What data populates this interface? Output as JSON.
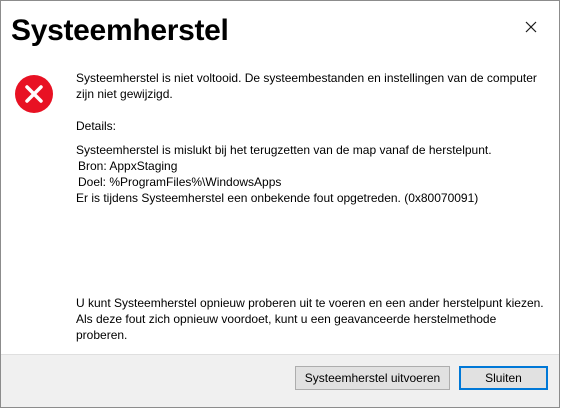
{
  "dialog": {
    "title": "Systeemherstel",
    "icons": {
      "close": "close-icon",
      "status": "error-icon"
    },
    "colors": {
      "error_red": "#e81123",
      "accent_blue": "#0078d7"
    },
    "message": {
      "summary": "Systeemherstel is niet voltooid. De systeembestanden en instellingen van de computer zijn niet gewijzigd.",
      "details_label": "Details:",
      "details_line1": "Systeemherstel is mislukt bij het terugzetten van de map vanaf de herstelpunt.",
      "details_line2": "Bron: AppxStaging",
      "details_line3": "Doel: %ProgramFiles%\\WindowsApps",
      "details_line4": "Er is tijdens Systeemherstel een onbekende fout opgetreden. (0x80070091)"
    },
    "hint": "U kunt Systeemherstel opnieuw proberen uit te voeren en een ander herstelpunt kiezen. Als deze fout zich opnieuw voordoet, kunt u een geavanceerde herstelmethode proberen.",
    "buttons": {
      "run_label": "Systeemherstel uitvoeren",
      "close_label": "Sluiten"
    }
  }
}
